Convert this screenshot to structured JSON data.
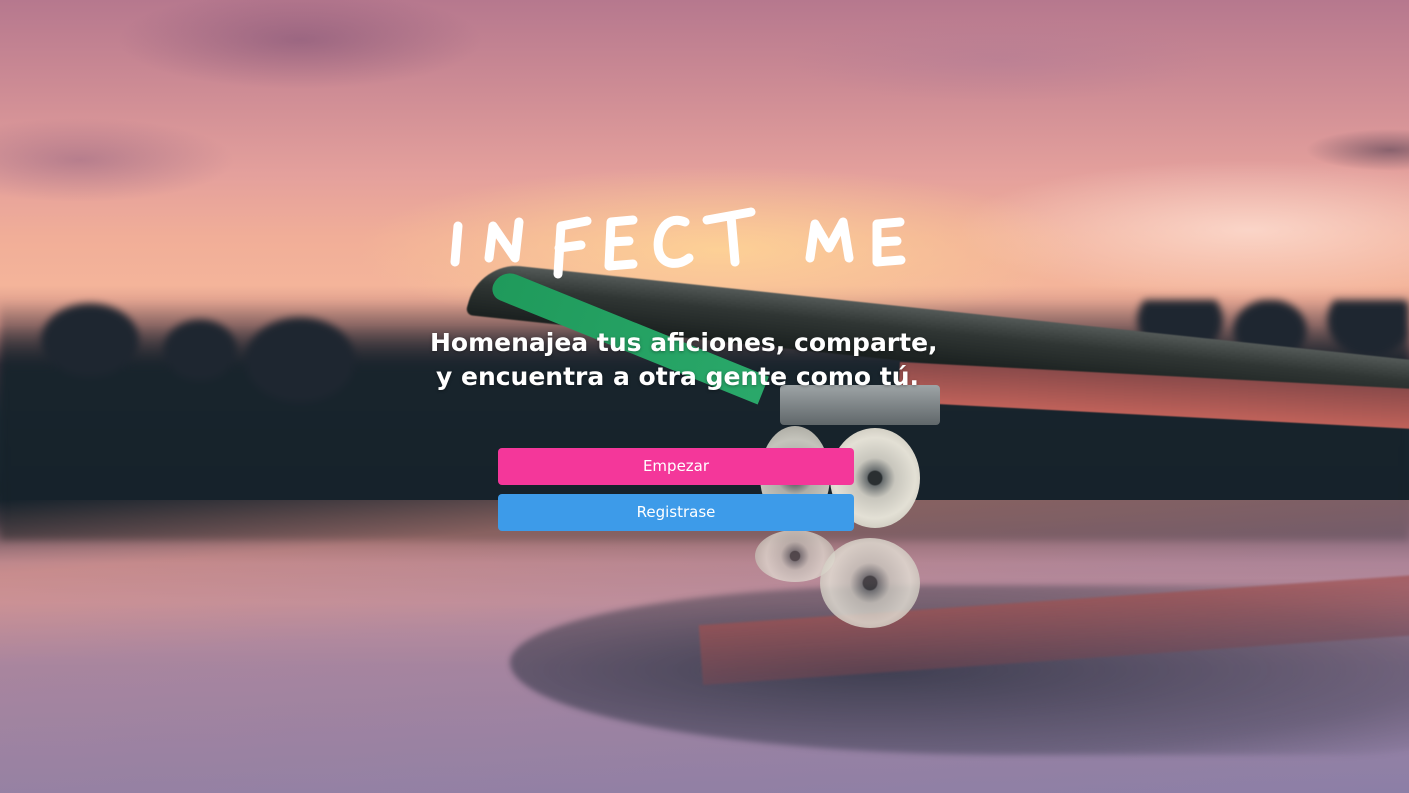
{
  "brand": {
    "logo_text": "INFECT ME",
    "logo_color": "#ffffff"
  },
  "hero": {
    "tagline_line1": "Homenajea tus aficiones, comparte,",
    "tagline_line2": "y encuentra a otra gente como tú."
  },
  "actions": {
    "start_label": "Empezar",
    "start_color": "#f4379a",
    "register_label": "Registrase",
    "register_color": "#3d9be9"
  },
  "background": {
    "description_icon": "skateboard-photo"
  }
}
